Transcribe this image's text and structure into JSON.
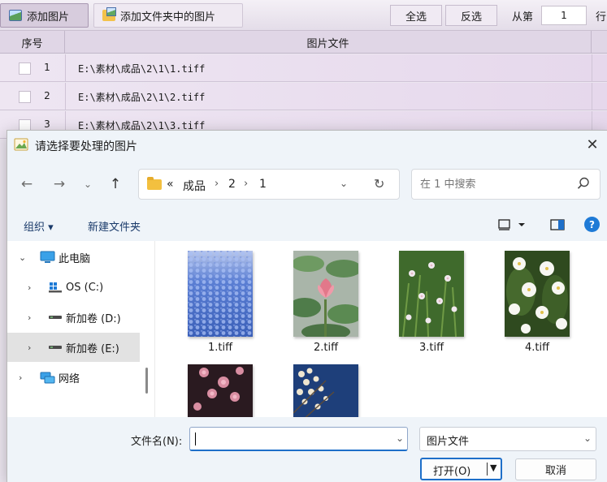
{
  "toolbar": {
    "add_images": "添加图片",
    "add_folder_images": "添加文件夹中的图片",
    "select_all": "全选",
    "invert_selection": "反选",
    "from_label": "从第",
    "from_value": "1",
    "row_label": "行"
  },
  "grid": {
    "columns": [
      "序号",
      "图片文件"
    ],
    "rows": [
      {
        "index": "1",
        "path": "E:\\素材\\成品\\2\\1\\1.tiff"
      },
      {
        "index": "2",
        "path": "E:\\素材\\成品\\2\\1\\2.tiff"
      },
      {
        "index": "3",
        "path": "E:\\素材\\成品\\2\\1\\3.tiff"
      }
    ]
  },
  "dialog": {
    "title": "请选择要处理的图片",
    "address": {
      "overflow": "«",
      "crumbs": [
        "成品",
        "2",
        "1"
      ]
    },
    "search_placeholder": "在 1 中搜索",
    "commands": {
      "organize": "组织 ▾",
      "new_folder": "新建文件夹"
    },
    "tree": [
      {
        "label": "此电脑"
      },
      {
        "label": "OS (C:)"
      },
      {
        "label": "新加卷 (D:)"
      },
      {
        "label": "新加卷 (E:)"
      },
      {
        "label": "网络"
      }
    ],
    "files": [
      {
        "name": "1.tiff"
      },
      {
        "name": "2.tiff"
      },
      {
        "name": "3.tiff"
      },
      {
        "name": "4.tiff"
      },
      {
        "name": ""
      },
      {
        "name": ""
      }
    ],
    "filename_label": "文件名(N):",
    "filename_value": "",
    "filetype_value": "图片文件",
    "open_label": "打开(O)",
    "cancel_label": "取消"
  }
}
